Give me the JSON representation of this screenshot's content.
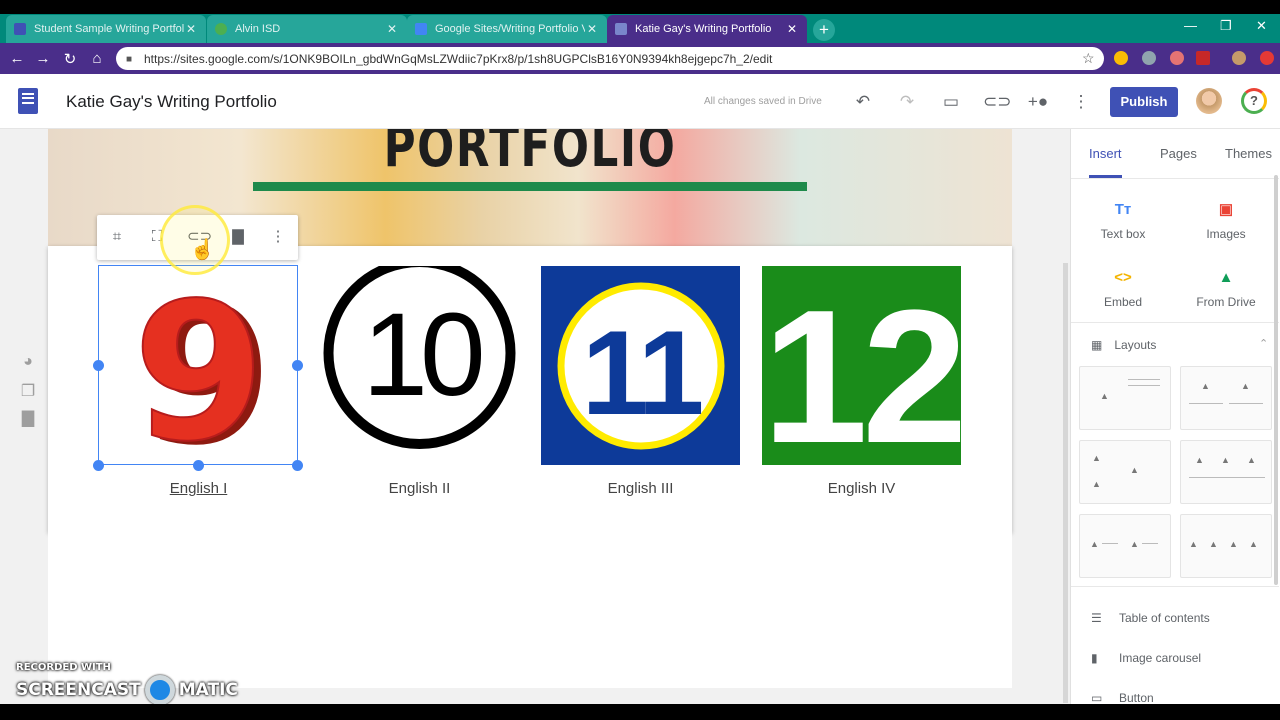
{
  "browser": {
    "tabs": [
      {
        "title": "Student Sample Writing Portfolio",
        "favicon_color": "#3f51b5"
      },
      {
        "title": "Alvin ISD",
        "favicon_color": "#4caf50"
      },
      {
        "title": "Google Sites/Writing Portfolio V",
        "favicon_color": "#4285f4"
      },
      {
        "title": "Katie Gay's Writing Portfolio",
        "favicon_color": "#7986cb"
      }
    ],
    "new_tab": "+",
    "url": "https://sites.google.com/s/1ONK9BOILn_gbdWnGqMsLZWdiic7pKrx8/p/1sh8UGPClsB16Y0N9394kh8ejgepc7h_2/edit"
  },
  "app": {
    "title": "Katie Gay's Writing Portfolio",
    "save_status": "All changes saved in Drive",
    "publish_label": "Publish",
    "help_label": "?"
  },
  "hero": {
    "title": "PORTFOLIO",
    "accent_color": "#1e8a4b"
  },
  "courses": [
    {
      "number": "9",
      "label": "English I",
      "selected": true
    },
    {
      "number": "10",
      "label": "English II"
    },
    {
      "number": "11",
      "label": "English III"
    },
    {
      "number": "12",
      "label": "English IV"
    }
  ],
  "panel": {
    "tabs": [
      "Insert",
      "Pages",
      "Themes"
    ],
    "insert_items": [
      {
        "label": "Text box",
        "icon": "text-box-icon",
        "glyph": "Tт",
        "color": "#4285f4"
      },
      {
        "label": "Images",
        "icon": "images-icon",
        "glyph": "▣",
        "color": "#ea4335"
      },
      {
        "label": "Embed",
        "icon": "embed-icon",
        "glyph": "<>",
        "color": "#f4b400"
      },
      {
        "label": "From Drive",
        "icon": "drive-icon",
        "glyph": "▲",
        "color": "#0f9d58"
      }
    ],
    "layouts_label": "Layouts",
    "list_items": [
      {
        "label": "Table of contents",
        "icon": "toc-icon"
      },
      {
        "label": "Image carousel",
        "icon": "carousel-icon"
      },
      {
        "label": "Button",
        "icon": "button-icon"
      }
    ]
  },
  "watermark": {
    "line1": "RECORDED WITH",
    "line2a": "SCREENCAST",
    "line2b": "MATIC"
  },
  "colors": {
    "tab_strip": "#00897b",
    "address_bar": "#4a2e8a",
    "primary": "#3f51b5",
    "selection": "#4285f4"
  }
}
